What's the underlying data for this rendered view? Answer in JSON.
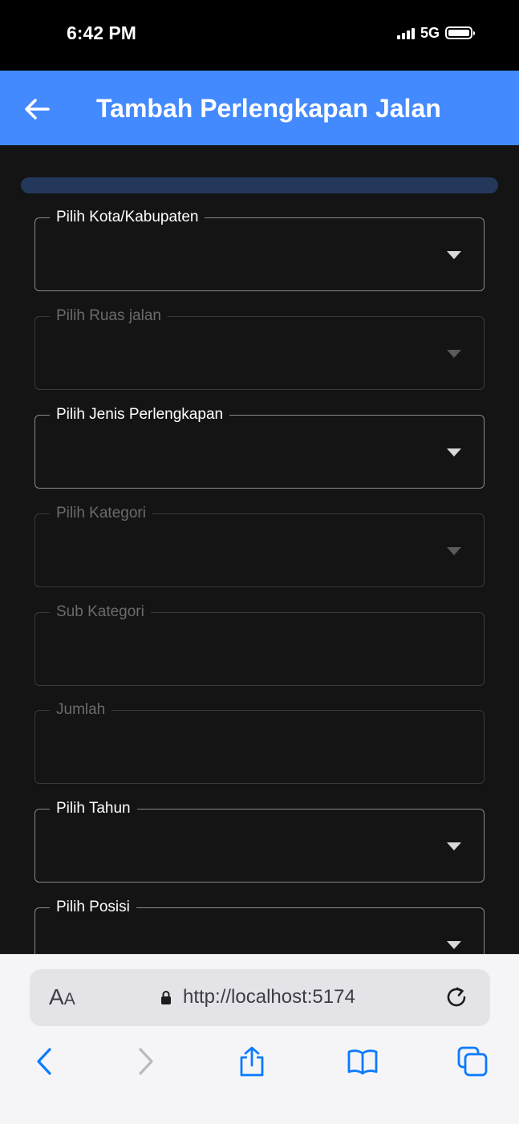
{
  "status": {
    "time": "6:42 PM",
    "network": "5G"
  },
  "header": {
    "title": "Tambah Perlengkapan Jalan",
    "back_icon": "arrow-left-icon"
  },
  "form": {
    "progress": 0,
    "fields": [
      {
        "label": "Pilih Kota/Kabupaten",
        "type": "select",
        "enabled": true
      },
      {
        "label": "Pilih Ruas jalan",
        "type": "select",
        "enabled": false
      },
      {
        "label": "Pilih Jenis Perlengkapan",
        "type": "select",
        "enabled": true
      },
      {
        "label": "Pilih Kategori",
        "type": "select",
        "enabled": false
      },
      {
        "label": "Sub Kategori",
        "type": "text",
        "enabled": false
      },
      {
        "label": "Jumlah",
        "type": "text",
        "enabled": false
      },
      {
        "label": "Pilih Tahun",
        "type": "select",
        "enabled": true
      },
      {
        "label": "Pilih Posisi",
        "type": "select",
        "enabled": true
      }
    ]
  },
  "browser": {
    "text_size_label_big": "A",
    "text_size_label_small": "A",
    "url": "http://localhost:5174",
    "icons": [
      "back-chevron-icon",
      "forward-chevron-icon",
      "share-icon",
      "bookmarks-icon",
      "tabs-icon"
    ]
  },
  "colors": {
    "accent": "#448aff",
    "background": "#141414",
    "progress_track": "#23385a",
    "ios_blue": "#0a7aff"
  }
}
